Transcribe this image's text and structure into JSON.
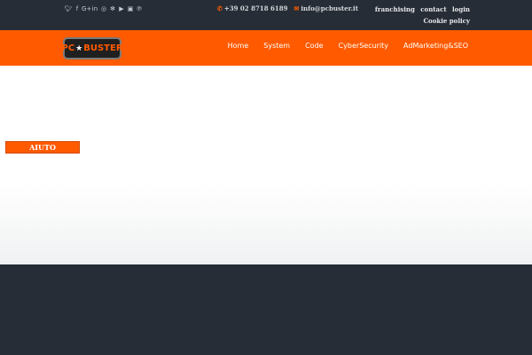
{
  "topbar": {
    "socials": [
      {
        "icon": "twitter-icon",
        "glyph": "🐦︎"
      },
      {
        "icon": "facebook-icon",
        "glyph": "f"
      },
      {
        "icon": "google-plus-icon",
        "glyph": "G+"
      },
      {
        "icon": "linkedin-icon",
        "glyph": "in"
      },
      {
        "icon": "instagram-icon",
        "glyph": "◎"
      },
      {
        "icon": "yelp-icon",
        "glyph": "✻"
      },
      {
        "icon": "youtube-icon",
        "glyph": "▶"
      },
      {
        "icon": "flickr-icon",
        "glyph": "▣"
      },
      {
        "icon": "pinterest-icon",
        "glyph": "℗"
      }
    ],
    "phone": "+39 02 8718 6189",
    "email": "info@pcbuster.it",
    "links": [
      "franchising",
      "contact",
      "login",
      "Cookie policy"
    ]
  },
  "logo": {
    "left": "PC",
    "right": "BUSTER"
  },
  "nav": [
    "Home",
    "System",
    "Code",
    "CyberSecurity",
    "AdMarketing&SEO"
  ],
  "hero": {
    "urgent_label": "AIUTO URGENTE!"
  },
  "colors": {
    "accent": "#ff5a00",
    "dark": "#272d36"
  }
}
